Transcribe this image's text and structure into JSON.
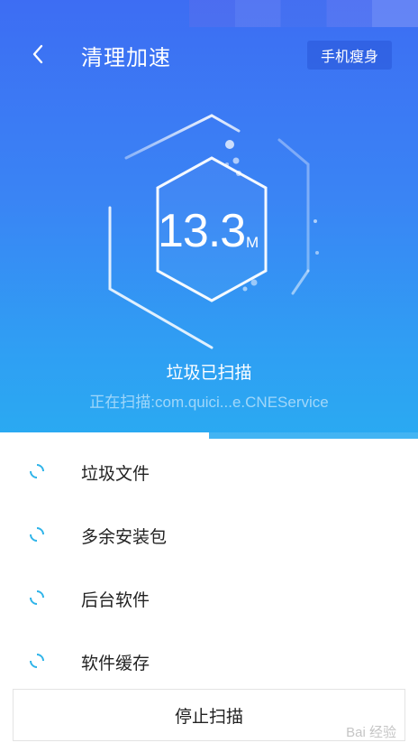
{
  "header": {
    "title": "清理加速",
    "right_button": "手机瘦身",
    "back_icon": "chevron-left-icon"
  },
  "scan": {
    "size_value": "13.3",
    "size_unit": "M",
    "status": "垃圾已扫描",
    "detail": "正在扫描:com.quici...e.CNEService",
    "progress": 0.5
  },
  "items": [
    {
      "label": "垃圾文件",
      "icon": "loading-spinner-icon"
    },
    {
      "label": "多余安装包",
      "icon": "loading-spinner-icon"
    },
    {
      "label": "后台软件",
      "icon": "loading-spinner-icon"
    },
    {
      "label": "软件缓存",
      "icon": "loading-spinner-icon"
    }
  ],
  "footer": {
    "stop_button": "停止扫描"
  },
  "watermark": "Bai 经验",
  "colors": {
    "hero_top": "#3d6df3",
    "hero_bottom": "#2aaaf2",
    "spinner": "#2fb4e9"
  }
}
